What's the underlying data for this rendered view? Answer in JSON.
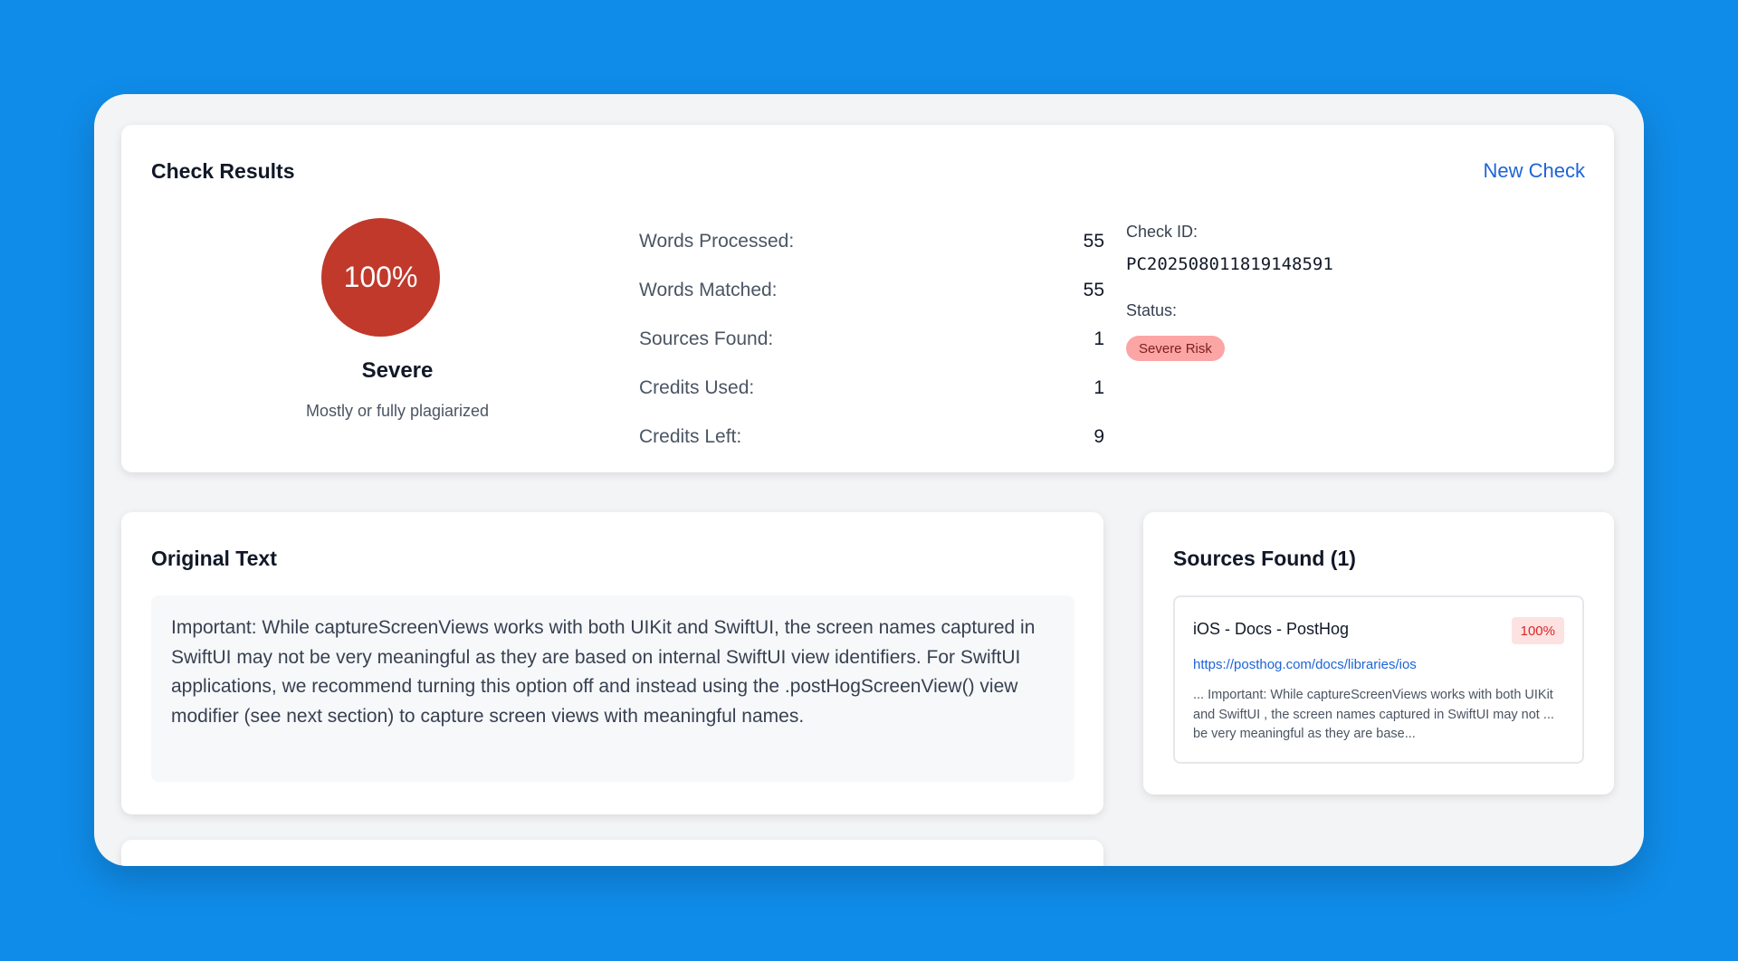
{
  "results": {
    "title": "Check Results",
    "new_check_label": "New Check",
    "score": "100%",
    "severity": "Severe",
    "severity_desc": "Mostly or fully plagiarized",
    "stats": [
      {
        "label": "Words Processed:",
        "value": "55"
      },
      {
        "label": "Words Matched:",
        "value": "55"
      },
      {
        "label": "Sources Found:",
        "value": "1"
      },
      {
        "label": "Credits Used:",
        "value": "1"
      },
      {
        "label": "Credits Left:",
        "value": "9"
      }
    ],
    "check_id_label": "Check ID:",
    "check_id": "PC202508011819148591",
    "status_label": "Status:",
    "status": "Severe Risk",
    "accent_color": "#c0392b"
  },
  "original": {
    "title": "Original Text",
    "text": "Important: While captureScreenViews works with both UIKit and SwiftUI, the screen names captured in SwiftUI may not be very meaningful as they are based on internal SwiftUI view identifiers. For SwiftUI applications, we recommend turning this option off and instead using the .postHogScreenView() view modifier (see next section) to capture screen views with meaningful names."
  },
  "sources": {
    "title": "Sources Found (1)",
    "items": [
      {
        "title": "iOS - Docs - PostHog",
        "percent": "100%",
        "url": "https://posthog.com/docs/libraries/ios",
        "snippet": "... Important: While captureScreenViews works with both UIKit and SwiftUI , the screen names captured in SwiftUI may not ... be very meaningful as they are base..."
      }
    ]
  }
}
